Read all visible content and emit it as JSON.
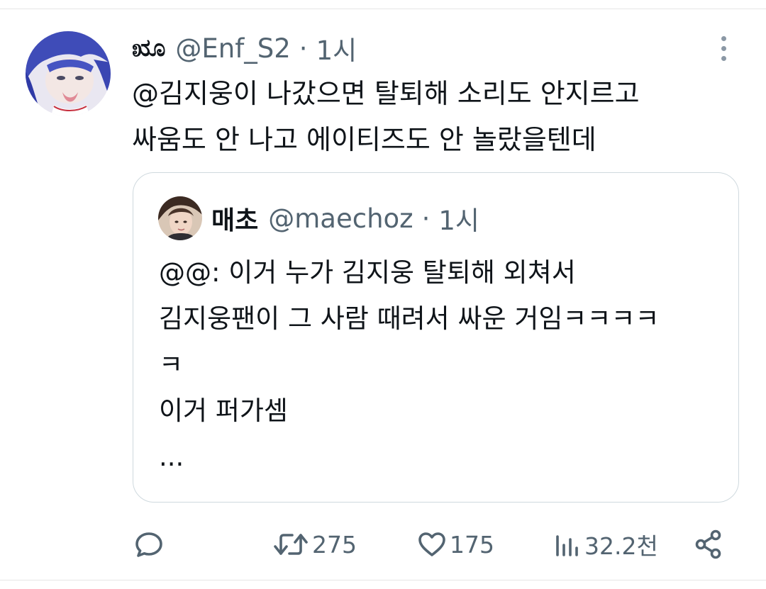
{
  "tweet": {
    "display_name_glyph": "ೠ",
    "handle": "@Enf_S2",
    "separator": "·",
    "time": "1시",
    "text": "@김지웅이 나갔으면 탈퇴해 소리도 안지르고\n싸움도 안 나고 에이티즈도 안 놀랐을텐데"
  },
  "quote": {
    "display_name": "매초",
    "handle": "@maechoz",
    "separator": "·",
    "time": "1시",
    "text": "@@: 이거 누가 김지웅 탈퇴해 외쳐서\n김지웅팬이 그 사람 때려서 싸운 거임ㅋㅋㅋㅋ\nㅋ\n이거 퍼가셈\n..."
  },
  "actions": {
    "reply_icon": "reply-icon",
    "retweet_icon": "retweet-icon",
    "retweet_count": "275",
    "like_icon": "heart-icon",
    "like_count": "175",
    "views_icon": "views-icon",
    "views_count": "32.2천",
    "share_icon": "share-icon"
  },
  "colors": {
    "text": "#0f1419",
    "secondary": "#536471",
    "border": "#cfd9de"
  }
}
